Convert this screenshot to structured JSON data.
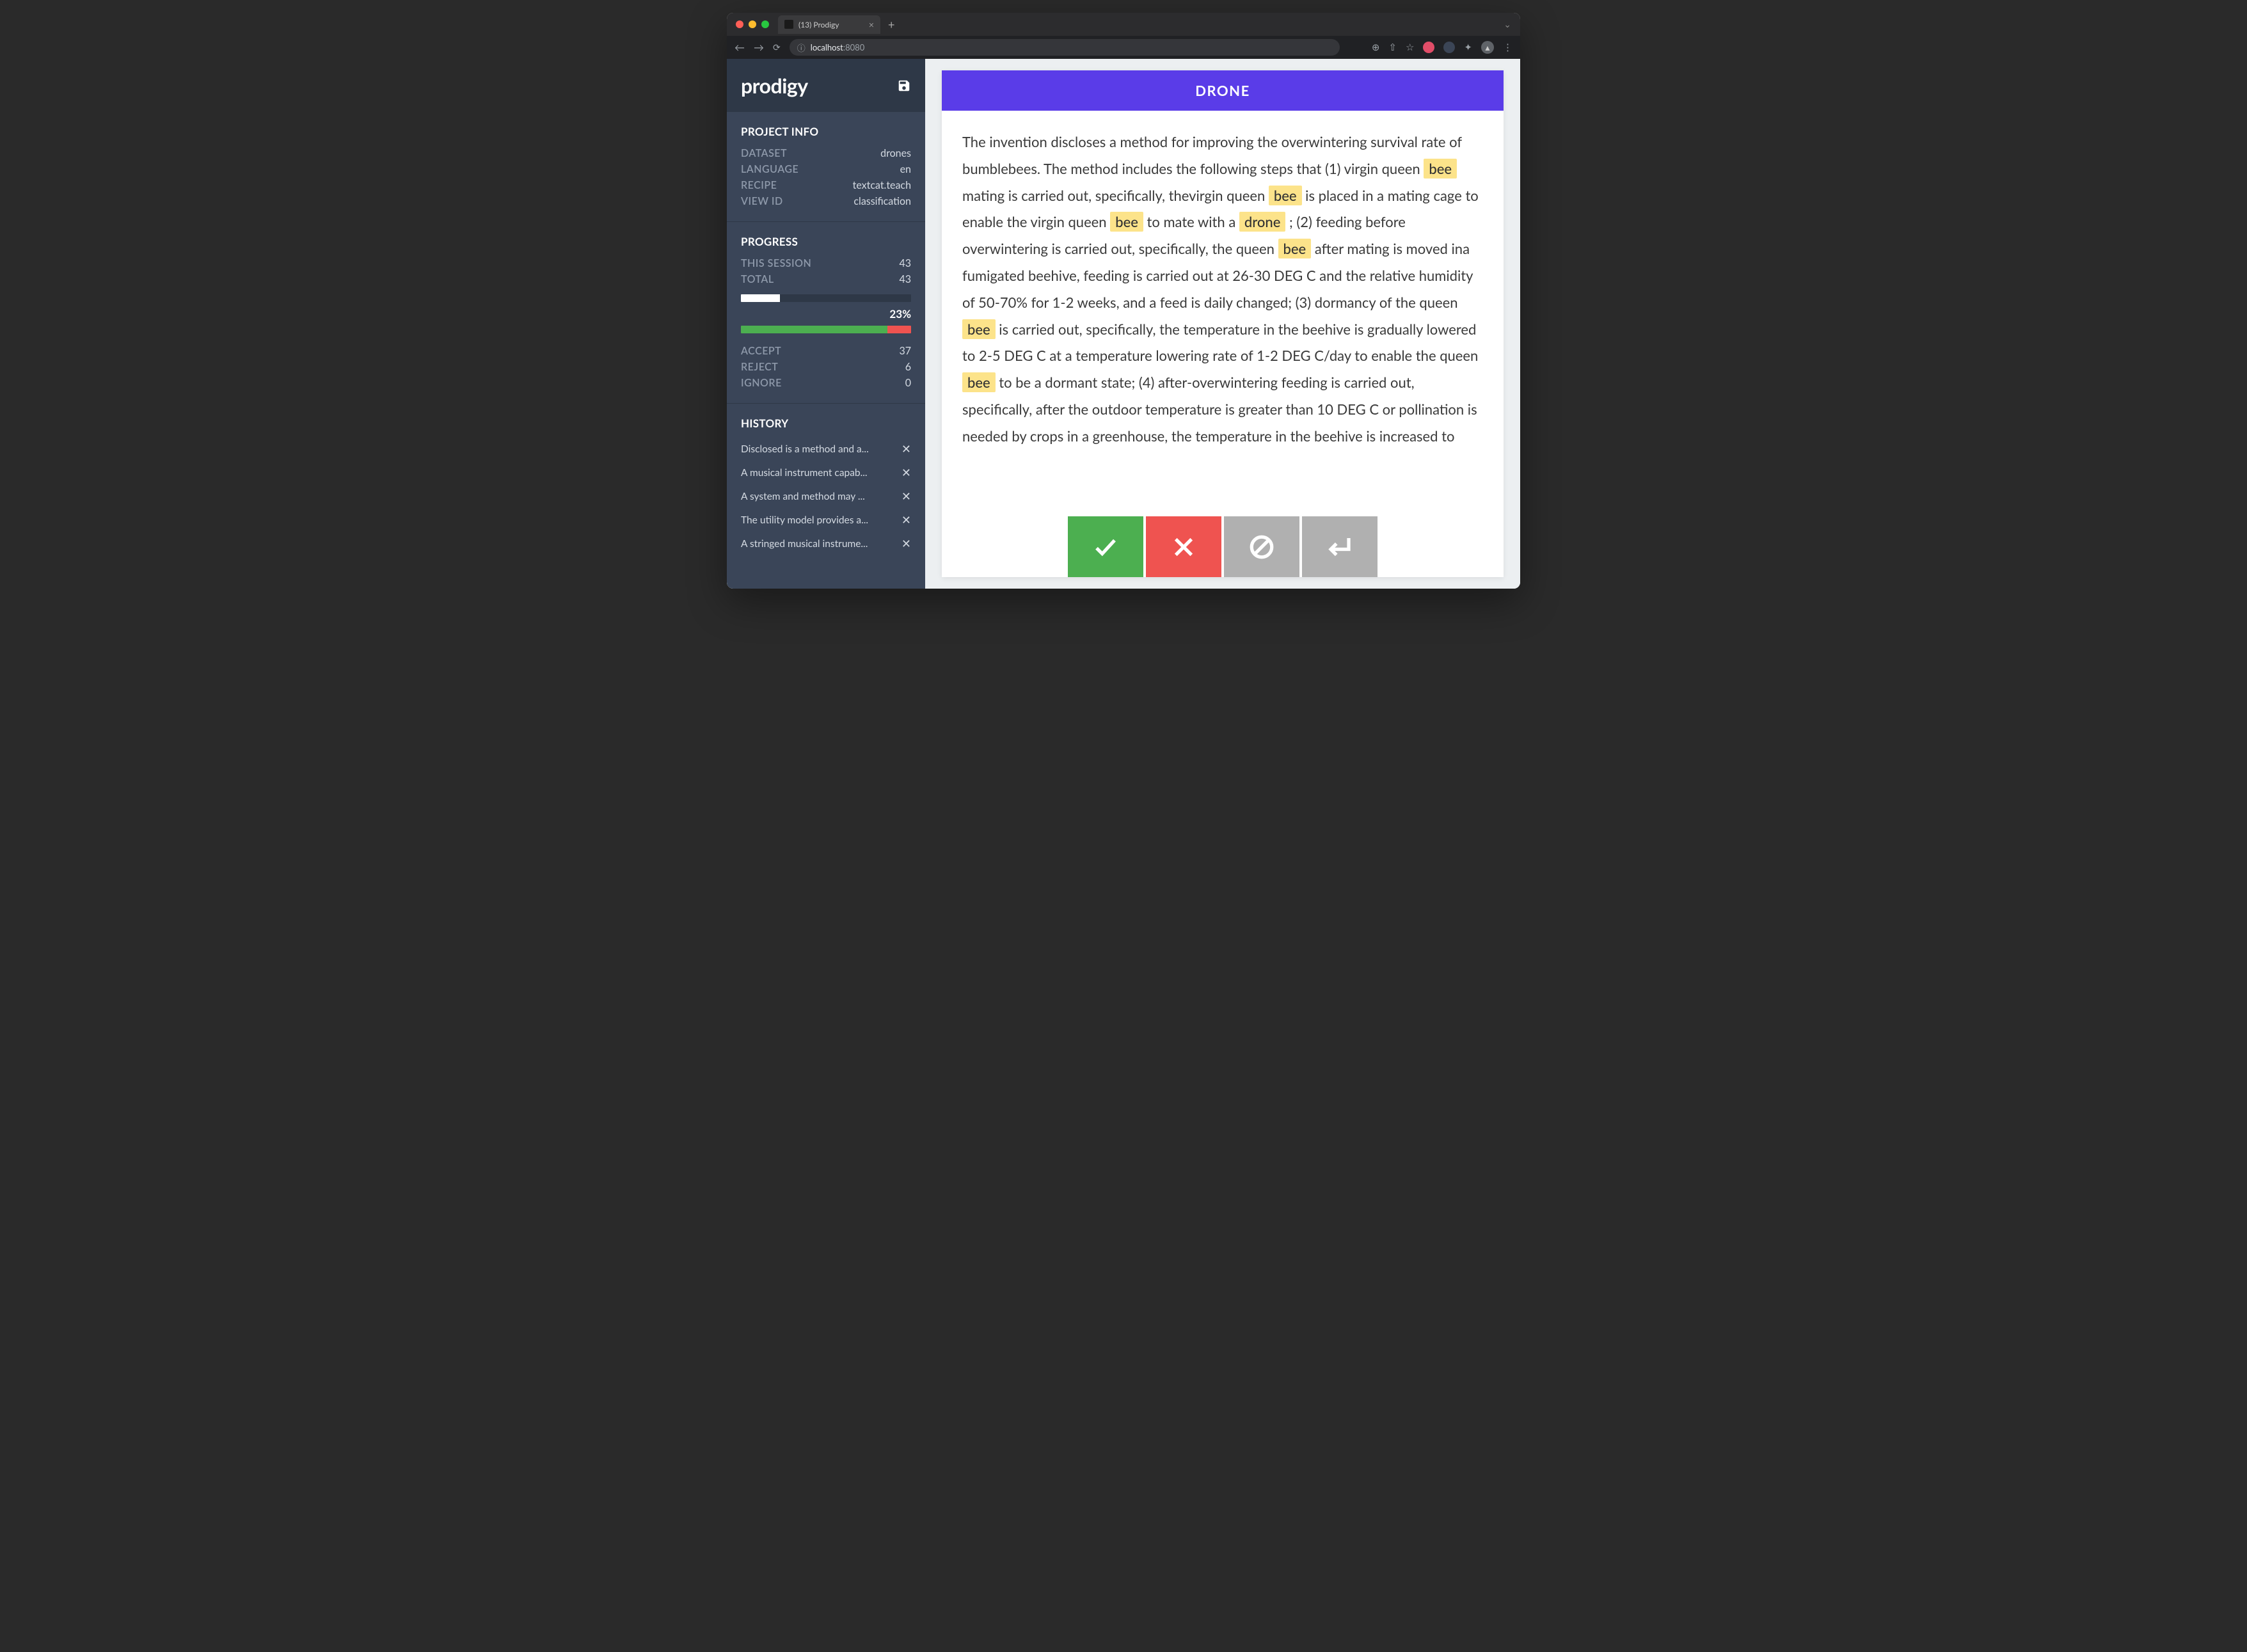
{
  "browser": {
    "tab_title": "(13) Prodigy",
    "url_host": "localhost",
    "url_port": ":8080"
  },
  "sidebar": {
    "logo": "prodigy",
    "project_info": {
      "heading": "PROJECT INFO",
      "dataset_k": "DATASET",
      "dataset_v": "drones",
      "language_k": "LANGUAGE",
      "language_v": "en",
      "recipe_k": "RECIPE",
      "recipe_v": "textcat.teach",
      "viewid_k": "VIEW ID",
      "viewid_v": "classification"
    },
    "progress": {
      "heading": "PROGRESS",
      "session_k": "THIS SESSION",
      "session_v": "43",
      "total_k": "TOTAL",
      "total_v": "43",
      "pct_label": "23%",
      "pct_value": 23,
      "accept_k": "ACCEPT",
      "accept_v": "37",
      "reject_k": "REJECT",
      "reject_v": "6",
      "ignore_k": "IGNORE",
      "ignore_v": "0",
      "split_accept_pct": 86,
      "split_reject_pct": 14
    },
    "history": {
      "heading": "HISTORY",
      "items": [
        "Disclosed is a method and a...",
        "A musical instrument capab...",
        "A system and method may ...",
        "The utility model provides a...",
        "A stringed musical instrume..."
      ]
    }
  },
  "task": {
    "label": "DRONE",
    "segments": [
      {
        "t": "The invention discloses a method for improving the overwintering survival rate of bumblebees. The method includes the following steps that (1) virgin queen "
      },
      {
        "t": "bee",
        "hl": true
      },
      {
        "t": " mating is carried out, specifically, thevirgin queen "
      },
      {
        "t": "bee",
        "hl": true
      },
      {
        "t": " is placed in a mating cage to enable the virgin queen "
      },
      {
        "t": "bee",
        "hl": true
      },
      {
        "t": " to mate with a "
      },
      {
        "t": "drone",
        "hl": true
      },
      {
        "t": " ; (2) feeding before overwintering is carried out, specifically, the queen "
      },
      {
        "t": "bee",
        "hl": true
      },
      {
        "t": " after mating is moved ina fumigated beehive, feeding is carried out at 26-30 DEG C and the relative humidity of 50-70% for 1-2 weeks, and a feed is daily changed; (3) dormancy of the queen "
      },
      {
        "t": "bee",
        "hl": true
      },
      {
        "t": " is carried out, specifically, the temperature in the beehive is gradually lowered to 2-5 DEG C at a temperature lowering rate of 1-2 DEG C/day to enable the queen "
      },
      {
        "t": "bee",
        "hl": true
      },
      {
        "t": " to be a dormant state; (4) after-overwintering feeding is carried out, specifically, after the outdoor temperature is greater than 10 DEG C or pollination is needed by crops in a greenhouse, the temperature in the beehive is increased to"
      }
    ]
  },
  "colors": {
    "accent": "#5a3ce8",
    "highlight": "#fce38a",
    "accept": "#4caf50",
    "reject": "#ef5350",
    "neutral": "#b0b0b0"
  }
}
